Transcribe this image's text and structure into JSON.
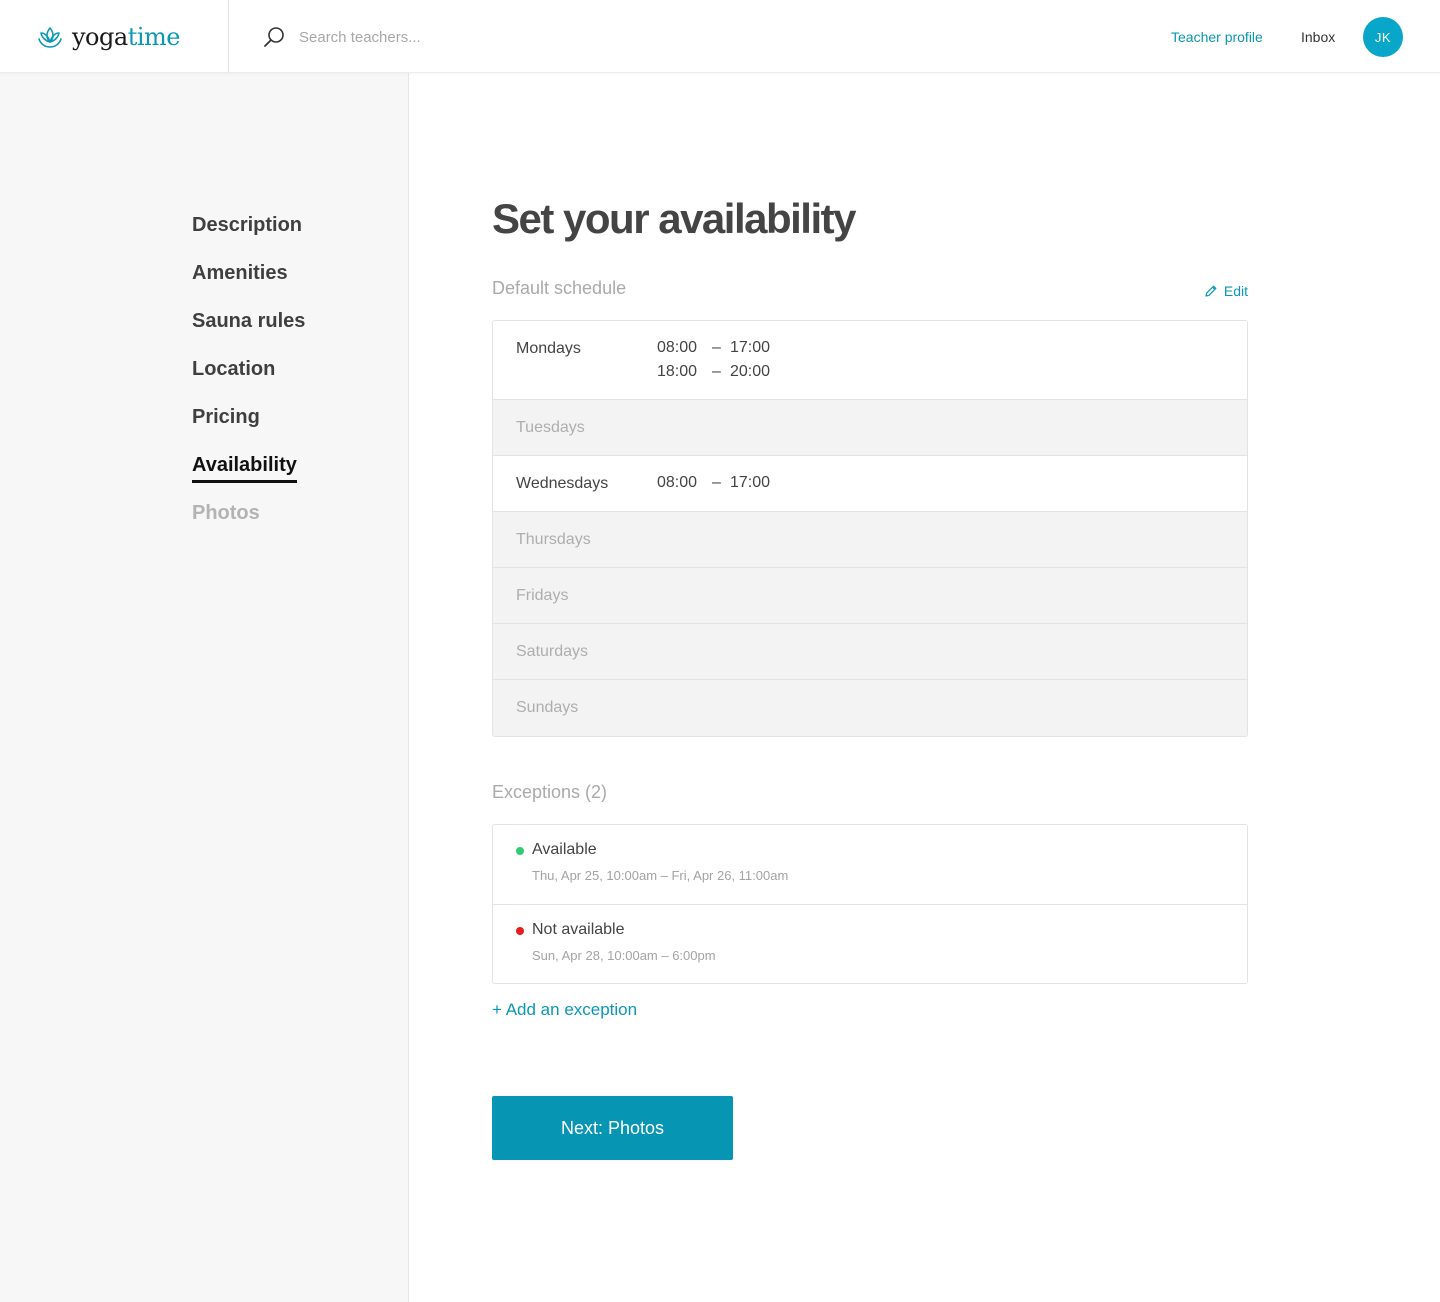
{
  "brand": {
    "name_part1": "yoga",
    "name_part2": "time",
    "color": "#0a98b5"
  },
  "search": {
    "placeholder": "Search teachers..."
  },
  "topnav": {
    "teacher_profile": "Teacher profile",
    "inbox": "Inbox",
    "avatar_initials": "JK"
  },
  "sidebar": {
    "items": [
      {
        "label": "Description",
        "state": "normal"
      },
      {
        "label": "Amenities",
        "state": "normal"
      },
      {
        "label": "Sauna rules",
        "state": "normal"
      },
      {
        "label": "Location",
        "state": "normal"
      },
      {
        "label": "Pricing",
        "state": "normal"
      },
      {
        "label": "Availability",
        "state": "active"
      },
      {
        "label": "Photos",
        "state": "disabled"
      }
    ]
  },
  "main": {
    "title": "Set your availability",
    "default_schedule_label": "Default schedule",
    "edit_label": "Edit",
    "days": [
      {
        "name": "Mondays",
        "slots": [
          {
            "start": "08:00",
            "end": "17:00"
          },
          {
            "start": "18:00",
            "end": "20:00"
          }
        ]
      },
      {
        "name": "Tuesdays",
        "slots": []
      },
      {
        "name": "Wednesdays",
        "slots": [
          {
            "start": "08:00",
            "end": "17:00"
          }
        ]
      },
      {
        "name": "Thursdays",
        "slots": []
      },
      {
        "name": "Fridays",
        "slots": []
      },
      {
        "name": "Saturdays",
        "slots": []
      },
      {
        "name": "Sundays",
        "slots": []
      }
    ],
    "dash": "–",
    "exceptions_label": "Exceptions (2)",
    "exceptions": [
      {
        "status": "Available",
        "range": "Thu, Apr 25, 10:00am – Fri, Apr 26, 11:00am",
        "color": "#2ecc71"
      },
      {
        "status": "Not available",
        "range": "Sun, Apr 28, 10:00am – 6:00pm",
        "color": "#e81c1c"
      }
    ],
    "add_exception": "+ Add an exception",
    "next_button": "Next: Photos"
  }
}
